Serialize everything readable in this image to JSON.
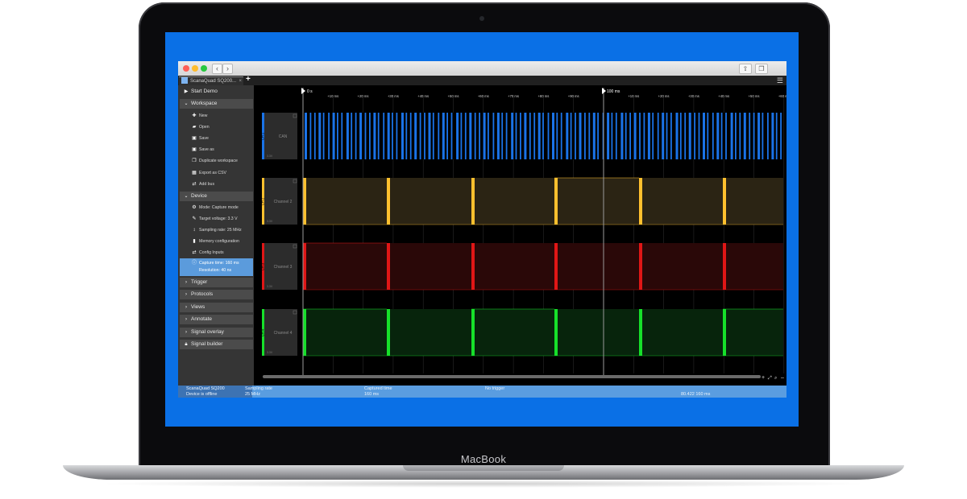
{
  "device": {
    "brand": "MacBook"
  },
  "tab": {
    "title": "ScanaQuad SQ200..."
  },
  "sidebar": {
    "start_demo": "Start Demo",
    "workspace": {
      "label": "Workspace",
      "items": [
        "New",
        "Open",
        "Save",
        "Save as",
        "Duplicate workspace",
        "Export as CSV",
        "Add bus"
      ]
    },
    "device": {
      "label": "Device",
      "items": [
        "Mode: Capture mode",
        "Target voltage: 3.3 V",
        "Sampling rate: 25 MHz",
        "Memory configuration",
        "Config Inputs"
      ],
      "selected_line1": "Capture time: 160 ms",
      "selected_line2": "Resolution: 40 ns"
    },
    "sections": [
      "Trigger",
      "Protocols",
      "Views",
      "Annotate",
      "Signal overlay",
      "Signal builder"
    ]
  },
  "status": {
    "device_name": "ScanaQuad SQ200",
    "device_state": "Device is offline",
    "sampling_label": "Sampling rate",
    "sampling_value": "25 MHz",
    "captured_label": "Captured time",
    "captured_value": "160 ms",
    "trigger_label": "No trigger",
    "cursor_value": "80.422 160 ms"
  },
  "timeline": {
    "start_label": "0 s",
    "mid_label": "100 ms",
    "ticks_left": [
      "+10 ms",
      "+20 ms",
      "+30 ms",
      "+40 ms",
      "+50 ms",
      "+60 ms",
      "+70 ms",
      "+80 ms",
      "+90 ms"
    ],
    "ticks_right": [
      "+10 ms",
      "+20 ms",
      "+30 ms",
      "+40 ms",
      "+50 ms",
      "+60 ms"
    ]
  },
  "channels": [
    {
      "id": "CH 1",
      "name": "CAN",
      "color": "#1a73e8",
      "fill": "#000000",
      "scale": "3.3V"
    },
    {
      "id": "CH 2",
      "name": "Channel 2",
      "color": "#ffc02e",
      "fill": "#2b2414",
      "scale": "3.3V"
    },
    {
      "id": "CH 3",
      "name": "Channel 3",
      "color": "#e01616",
      "fill": "#2a0808",
      "scale": "3.3V"
    },
    {
      "id": "CH 4",
      "name": "Channel 4",
      "color": "#16e02a",
      "fill": "#07240c",
      "scale": "3.3V"
    }
  ],
  "colors": {
    "screen": "#0a70e6",
    "status": "#5a9de0",
    "selected": "#5b9bdc"
  },
  "icons": [
    "play-icon",
    "chevron-down-icon",
    "chevron-right-icon",
    "plus-icon",
    "folder-icon",
    "save-icon",
    "copy-icon",
    "table-icon",
    "link-icon",
    "gear-icon",
    "wrench-icon",
    "arrow-icon",
    "memory-icon",
    "switch-icon",
    "info-icon",
    "lock-icon",
    "settings-icon",
    "share-icon",
    "window-icon"
  ]
}
